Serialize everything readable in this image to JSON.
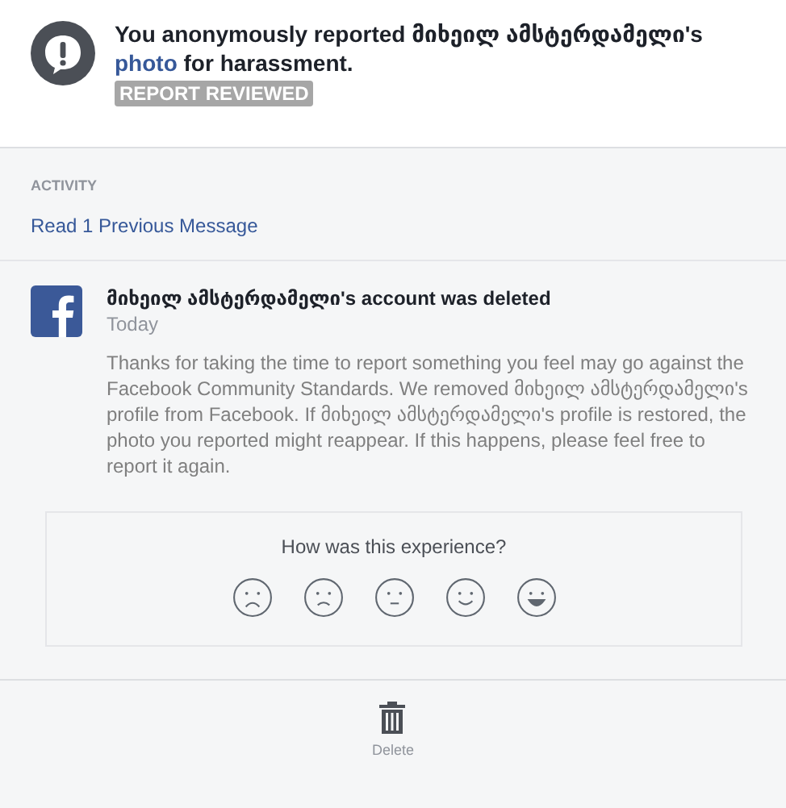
{
  "header": {
    "title_before": "You anonymously reported მიხეილ ამსტერდამელი's ",
    "title_link": "photo",
    "title_after": " for harassment.",
    "status_badge": "REPORT REVIEWED"
  },
  "activity": {
    "heading": "ACTIVITY",
    "previous_link": "Read 1 Previous Message"
  },
  "message": {
    "title": "მიხეილ ამსტერდამელი's account was deleted",
    "time": "Today",
    "body": "Thanks for taking the time to report something you feel may go against the Facebook Community Standards. We removed მიხეილ ამსტერდამელი's profile from Facebook. If მიხეილ ამსტერდამელი's profile is restored, the photo you reported might reappear. If this happens, please feel free to report it again."
  },
  "feedback": {
    "question": "How was this experience?"
  },
  "footer": {
    "delete_label": "Delete"
  }
}
